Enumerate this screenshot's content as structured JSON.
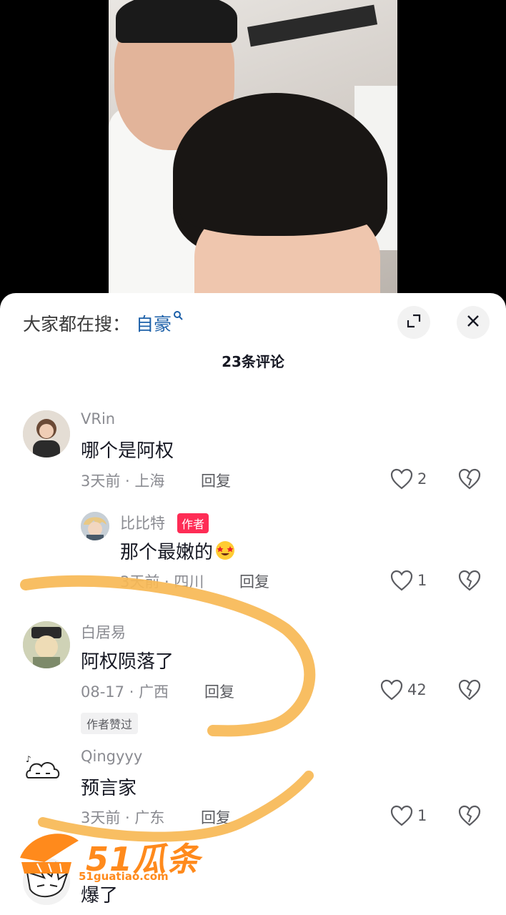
{
  "search": {
    "prefix": "大家都在搜：",
    "keyword": "自豪"
  },
  "header": {
    "comment_count_label": "23条评论"
  },
  "comments": [
    {
      "user": "VRin",
      "text": "哪个是阿权",
      "time": "3天前",
      "location": "上海",
      "reply": "回复",
      "likes": "2"
    },
    {
      "user": "比比特",
      "author_tag": "作者",
      "text": "那个最嫩的",
      "time": "3天前",
      "location": "四川",
      "reply": "回复",
      "likes": "1"
    },
    {
      "user": "白居易",
      "text": "阿权陨落了",
      "time": "08-17",
      "location": "广西",
      "reply": "回复",
      "likes": "42",
      "badge": "作者赞过"
    },
    {
      "user": "Qingyyy",
      "text": "预言家",
      "time": "3天前",
      "location": "广东",
      "reply": "回复",
      "likes": "1"
    },
    {
      "text": "爆了"
    }
  ],
  "watermark": {
    "logo": "51瓜条",
    "url": "51guatiao.com"
  },
  "colors": {
    "accent_link": "#1b5fa8",
    "author_tag": "#fe2c55",
    "annotation_stroke": "#f7b955",
    "watermark": "#ff8a1c"
  }
}
